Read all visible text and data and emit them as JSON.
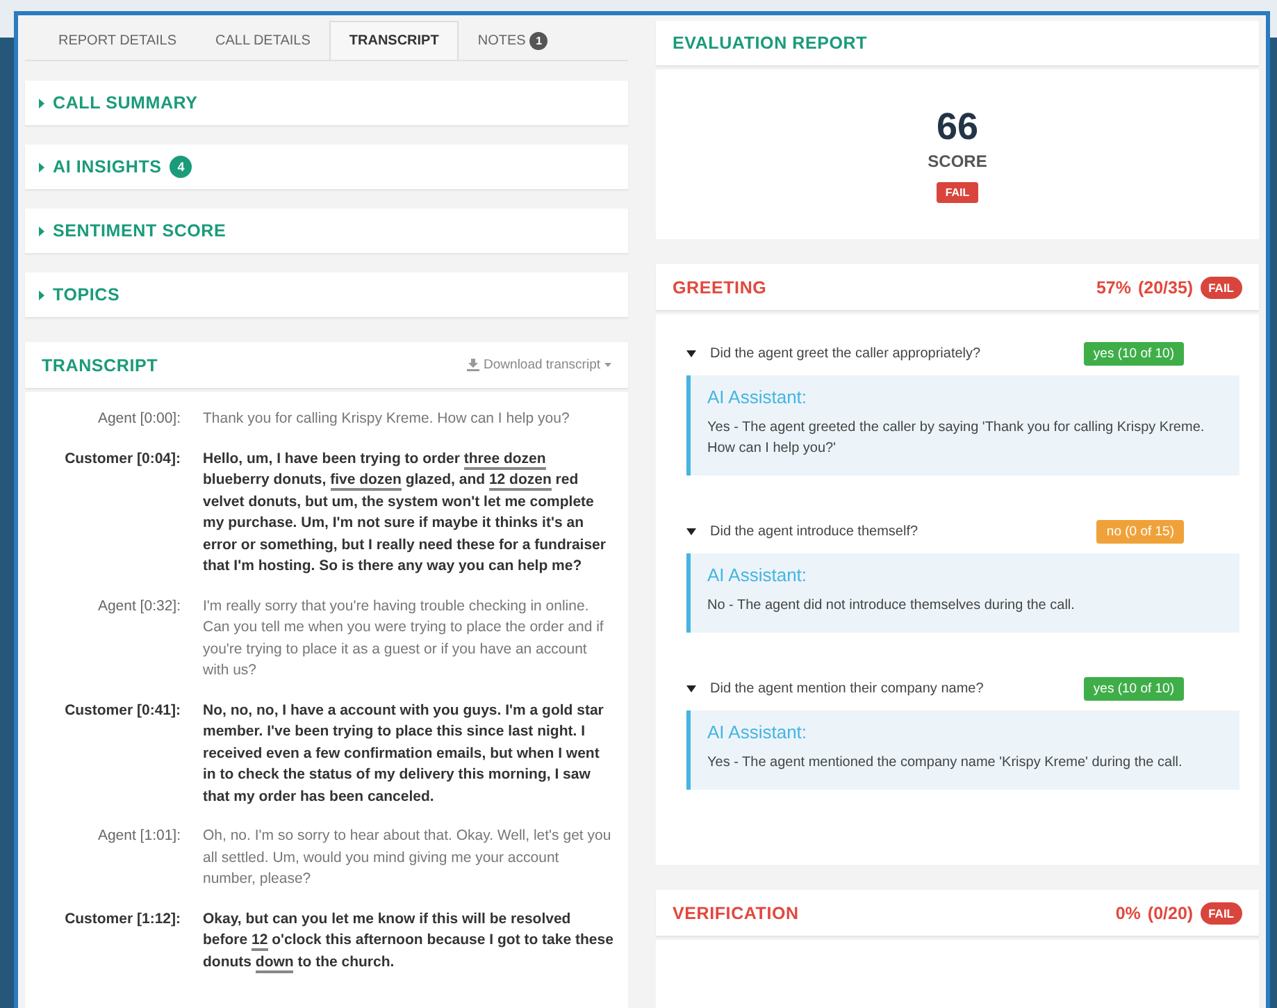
{
  "tabs": [
    {
      "label": "REPORT DETAILS",
      "selected": false
    },
    {
      "label": "CALL DETAILS",
      "selected": false
    },
    {
      "label": "TRANSCRIPT",
      "selected": true
    },
    {
      "label": "NOTES",
      "selected": false,
      "badge": "1"
    }
  ],
  "sections": [
    {
      "title": "CALL SUMMARY"
    },
    {
      "title": "AI INSIGHTS",
      "badge": "4"
    },
    {
      "title": "SENTIMENT SCORE"
    },
    {
      "title": "TOPICS"
    }
  ],
  "transcript": {
    "title": "TRANSCRIPT",
    "download": "Download transcript",
    "lines": [
      {
        "kind": "agent",
        "speaker": "Agent [0:00]:",
        "segments": [
          {
            "text": "Thank you for calling Krispy Kreme. How can I help you?",
            "marked": false
          }
        ]
      },
      {
        "kind": "customer",
        "speaker": "Customer [0:04]:",
        "segments": [
          {
            "text": "Hello, um, I have been trying to order ",
            "marked": false
          },
          {
            "text": "three dozen",
            "marked": true
          },
          {
            "text": " blueberry donuts, ",
            "marked": false
          },
          {
            "text": "five dozen",
            "marked": true
          },
          {
            "text": " glazed, and ",
            "marked": false
          },
          {
            "text": "12 dozen",
            "marked": true
          },
          {
            "text": " red velvet donuts, but um, the system won't let me complete my purchase. Um, I'm not sure if maybe it thinks it's an error or something, but I really need these for a fundraiser that I'm hosting. So is there any way you can help me?",
            "marked": false
          }
        ]
      },
      {
        "kind": "agent",
        "speaker": "Agent [0:32]:",
        "segments": [
          {
            "text": "I'm really sorry that you're having trouble checking in online. Can you tell me when you were trying to place the order and if you're trying to place it as a guest or if you have an account with us?",
            "marked": false
          }
        ]
      },
      {
        "kind": "customer",
        "speaker": "Customer [0:41]:",
        "segments": [
          {
            "text": "No, no, no, I have a account with you guys. I'm a gold star member. I've been trying to place this since last night. I received even a few confirmation emails, but when I went in to check the status of my delivery this morning, I saw that my order has been canceled.",
            "marked": false
          }
        ]
      },
      {
        "kind": "agent",
        "speaker": "Agent [1:01]:",
        "segments": [
          {
            "text": "Oh, no. I'm so sorry to hear about that. Okay. Well, let's get you all settled. Um, would you mind giving me your account number, please?",
            "marked": false
          }
        ]
      },
      {
        "kind": "customer",
        "speaker": "Customer [1:12]:",
        "segments": [
          {
            "text": "Okay, but can you let me know if this will be resolved before ",
            "marked": false
          },
          {
            "text": "12",
            "marked": true
          },
          {
            "text": " o'clock this afternoon because I got to take these donuts ",
            "marked": false
          },
          {
            "text": "down",
            "marked": true
          },
          {
            "text": " to the church.",
            "marked": false
          }
        ]
      }
    ]
  },
  "evaluation": {
    "title": "EVALUATION REPORT",
    "score": "66",
    "score_label": "SCORE",
    "result": "FAIL"
  },
  "categories": [
    {
      "name": "GREETING",
      "percent": "57%",
      "fraction": "(20/35)",
      "result": "FAIL",
      "questions": [
        {
          "question": "Did the agent greet the caller appropriately?",
          "answer": "yes (10 of 10)",
          "passed": true,
          "assistant": "AI Assistant:",
          "explanation": "Yes - The agent greeted the caller by saying 'Thank you for calling Krispy Kreme. How can I help you?'"
        },
        {
          "question": "Did the agent introduce themself?",
          "answer": "no (0 of 15)",
          "passed": false,
          "assistant": "AI Assistant:",
          "explanation": "No - The agent did not introduce themselves during the call."
        },
        {
          "question": "Did the agent mention their company name?",
          "answer": "yes (10 of 10)",
          "passed": true,
          "assistant": "AI Assistant:",
          "explanation": "Yes - The agent mentioned the company name 'Krispy Kreme' during the call."
        }
      ]
    },
    {
      "name": "VERIFICATION",
      "percent": "0%",
      "fraction": "(0/20)",
      "result": "FAIL"
    }
  ]
}
